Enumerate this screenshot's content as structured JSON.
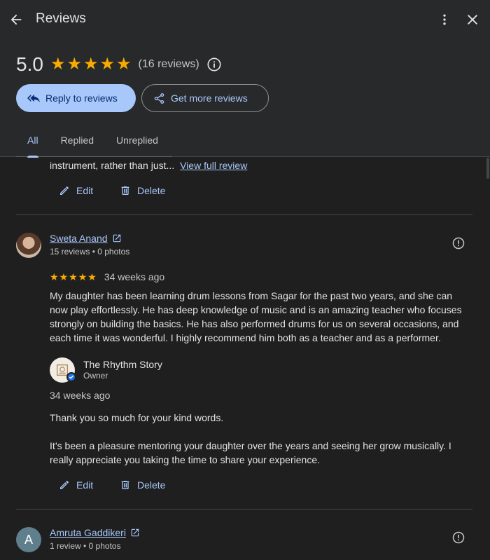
{
  "header": {
    "title": "Reviews",
    "rating": "5.0",
    "star_count": 5,
    "review_count": "(16 reviews)",
    "reply_button": "Reply to reviews",
    "more_reviews_button": "Get more reviews",
    "tabs": [
      {
        "label": "All",
        "active": true
      },
      {
        "label": "Replied",
        "active": false
      },
      {
        "label": "Unreplied",
        "active": false
      }
    ]
  },
  "colors": {
    "accent": "#a8c7fa",
    "star": "#f9ab00",
    "background": "#1f1f1f",
    "header_background": "#28292a"
  },
  "reviews": [
    {
      "truncated_text": "instrument, rather than just...",
      "view_full": "View full review",
      "edit": "Edit",
      "delete": "Delete"
    },
    {
      "author": "Sweta Anand",
      "meta": "15 reviews • 0 photos",
      "stars": 5,
      "time": "34 weeks ago",
      "text": "My daughter has been learning drum lessons from Sagar for the past two years, and she can now play effortlessly. He has deep knowledge of music and is an amazing teacher who focuses strongly on building the basics. He has also performed drums for us on several occasions, and each time it was wonderful. I highly recommend him both as a teacher and as a performer.",
      "reply": {
        "owner_name": "The Rhythm Story",
        "owner_role": "Owner",
        "time": "34 weeks ago",
        "paragraph1": "Thank you so much for your kind words.",
        "paragraph2": "It’s been a pleasure mentoring your daughter over the years and seeing her grow musically. I really appreciate you taking the time to share your experience."
      },
      "edit": "Edit",
      "delete": "Delete"
    },
    {
      "author": "Amruta Gaddikeri",
      "avatar_letter": "A",
      "meta": "1 review • 0 photos"
    }
  ]
}
